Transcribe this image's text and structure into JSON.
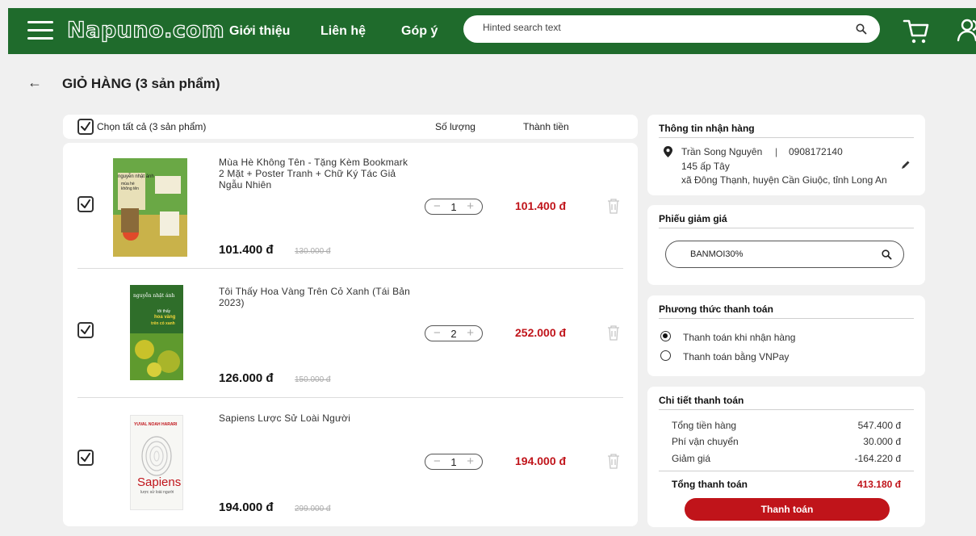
{
  "header": {
    "logo": "Napuno.com",
    "nav": [
      "Giới thiệu",
      "Liên hệ",
      "Góp ý"
    ],
    "search_placeholder": "Hinted search text",
    "brand_color": "#1f6b2c",
    "icons": [
      "menu-icon",
      "search-icon",
      "cart-icon",
      "user-icon"
    ]
  },
  "page": {
    "back_icon": "←",
    "title": "GIỎ HÀNG (3 sản phẩm)"
  },
  "cart": {
    "select_all": "Chọn tất cả (3 sản phẩm)",
    "col_qty": "Số lượng",
    "col_total": "Thành tiền",
    "items": [
      {
        "name": "Mùa Hè Không Tên - Tặng Kèm Bookmark 2 Mặt + Poster Tranh + Chữ Ký Tác Giả Ngẫu Nhiên",
        "price": "101.400 đ",
        "old_price": "130.000 đ",
        "qty": "1",
        "line_total": "101.400 đ",
        "checked": true
      },
      {
        "name": "Tôi Thấy Hoa Vàng Trên Cỏ Xanh (Tái Bản 2023)",
        "price": "126.000 đ",
        "old_price": "150.000 đ",
        "qty": "2",
        "line_total": "252.000 đ",
        "checked": true
      },
      {
        "name": "Sapiens Lược Sử Loài Người",
        "price": "194.000 đ",
        "old_price": "299.000 đ",
        "qty": "1",
        "line_total": "194.000 đ",
        "checked": true
      }
    ]
  },
  "covers": {
    "book1_author": "nguyễn nhật ánh",
    "book1_title": "mùa hè không tên",
    "book2_author": "nguyễn nhật ánh",
    "book2_title1": "tôi thấy",
    "book2_title2": "hoa vàng",
    "book2_title3": "trên cỏ xanh",
    "book3_author": "YUVAL NOAH HARARI",
    "book3_title": "Sapiens",
    "book3_sub": "lược sử loài người"
  },
  "shipping": {
    "title": "Thông tin nhận hàng",
    "name": "Trần Song Nguyên",
    "sep": "|",
    "phone": "0908172140",
    "street": "145 ấp Tây",
    "region": "xã Đông Thạnh, huyện Cần Giuộc, tỉnh Long An"
  },
  "coupon": {
    "title": "Phiếu giảm giá",
    "code": "BANMOI30%"
  },
  "payment": {
    "title": "Phương thức thanh toán",
    "options": [
      "Thanh toán khi nhận hàng",
      "Thanh toán bằng VNPay"
    ],
    "selected": 0
  },
  "summary": {
    "title": "Chi tiết thanh toán",
    "rows": [
      {
        "label": "Tổng tiền hàng",
        "value": "547.400 đ"
      },
      {
        "label": "Phí vận chuyển",
        "value": "30.000 đ"
      },
      {
        "label": "Giảm giá",
        "value": "-164.220 đ"
      }
    ],
    "grand_label": "Tổng thanh toán",
    "grand_value": "413.180 đ",
    "pay_button": "Thanh toán",
    "accent": "#c0141a"
  }
}
